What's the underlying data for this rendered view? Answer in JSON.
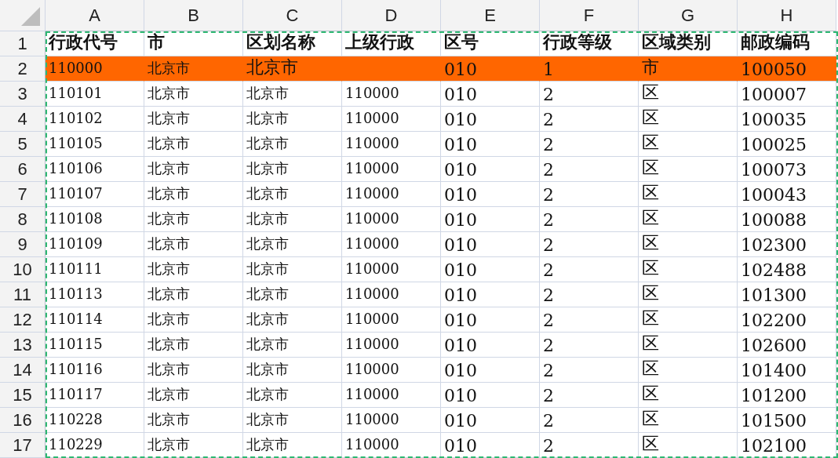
{
  "columns": [
    "A",
    "B",
    "C",
    "D",
    "E",
    "F",
    "G",
    "H"
  ],
  "rows": [
    {
      "number": "1",
      "highlighted": false,
      "header": true,
      "cells": [
        "行政代号",
        "市",
        "区划名称",
        "上级行政",
        "区号",
        "行政等级",
        "区域类别",
        "邮政编码"
      ]
    },
    {
      "number": "2",
      "highlighted": true,
      "header": false,
      "cells": [
        "110000",
        "北京市",
        "北京市",
        null,
        "010",
        "1",
        "市",
        "100050"
      ]
    },
    {
      "number": "3",
      "highlighted": false,
      "header": false,
      "cells": [
        "110101",
        "北京市",
        "北京市",
        "110000",
        "010",
        "2",
        "区",
        "100007"
      ]
    },
    {
      "number": "4",
      "highlighted": false,
      "header": false,
      "cells": [
        "110102",
        "北京市",
        "北京市",
        "110000",
        "010",
        "2",
        "区",
        "100035"
      ]
    },
    {
      "number": "5",
      "highlighted": false,
      "header": false,
      "cells": [
        "110105",
        "北京市",
        "北京市",
        "110000",
        "010",
        "2",
        "区",
        "100025"
      ]
    },
    {
      "number": "6",
      "highlighted": false,
      "header": false,
      "cells": [
        "110106",
        "北京市",
        "北京市",
        "110000",
        "010",
        "2",
        "区",
        "100073"
      ]
    },
    {
      "number": "7",
      "highlighted": false,
      "header": false,
      "cells": [
        "110107",
        "北京市",
        "北京市",
        "110000",
        "010",
        "2",
        "区",
        "100043"
      ]
    },
    {
      "number": "8",
      "highlighted": false,
      "header": false,
      "cells": [
        "110108",
        "北京市",
        "北京市",
        "110000",
        "010",
        "2",
        "区",
        "100088"
      ]
    },
    {
      "number": "9",
      "highlighted": false,
      "header": false,
      "cells": [
        "110109",
        "北京市",
        "北京市",
        "110000",
        "010",
        "2",
        "区",
        "102300"
      ]
    },
    {
      "number": "10",
      "highlighted": false,
      "header": false,
      "cells": [
        "110111",
        "北京市",
        "北京市",
        "110000",
        "010",
        "2",
        "区",
        "102488"
      ]
    },
    {
      "number": "11",
      "highlighted": false,
      "header": false,
      "cells": [
        "110113",
        "北京市",
        "北京市",
        "110000",
        "010",
        "2",
        "区",
        "101300"
      ]
    },
    {
      "number": "12",
      "highlighted": false,
      "header": false,
      "cells": [
        "110114",
        "北京市",
        "北京市",
        "110000",
        "010",
        "2",
        "区",
        "102200"
      ]
    },
    {
      "number": "13",
      "highlighted": false,
      "header": false,
      "cells": [
        "110115",
        "北京市",
        "北京市",
        "110000",
        "010",
        "2",
        "区",
        "102600"
      ]
    },
    {
      "number": "14",
      "highlighted": false,
      "header": false,
      "cells": [
        "110116",
        "北京市",
        "北京市",
        "110000",
        "010",
        "2",
        "区",
        "101400"
      ]
    },
    {
      "number": "15",
      "highlighted": false,
      "header": false,
      "cells": [
        "110117",
        "北京市",
        "北京市",
        "110000",
        "010",
        "2",
        "区",
        "101200"
      ]
    },
    {
      "number": "16",
      "highlighted": false,
      "header": false,
      "cells": [
        "110228",
        "北京市",
        "北京市",
        "110000",
        "010",
        "2",
        "区",
        "101500"
      ]
    },
    {
      "number": "17",
      "highlighted": false,
      "header": false,
      "cells": [
        "110229",
        "北京市",
        "北京市",
        "110000",
        "010",
        "2",
        "区",
        "102100"
      ]
    }
  ]
}
